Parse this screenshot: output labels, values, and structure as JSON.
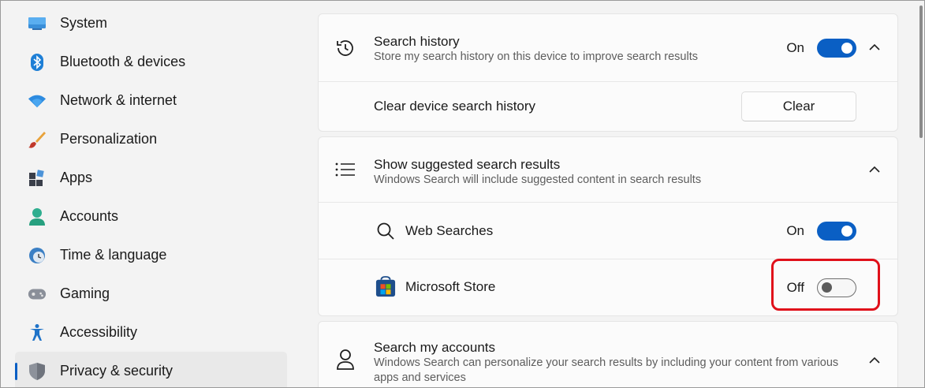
{
  "sidebar": {
    "items": [
      {
        "label": "System",
        "icon": "monitor-icon"
      },
      {
        "label": "Bluetooth & devices",
        "icon": "bluetooth-icon"
      },
      {
        "label": "Network & internet",
        "icon": "wifi-icon"
      },
      {
        "label": "Personalization",
        "icon": "brush-icon"
      },
      {
        "label": "Apps",
        "icon": "apps-icon"
      },
      {
        "label": "Accounts",
        "icon": "person-icon"
      },
      {
        "label": "Time & language",
        "icon": "clock-globe-icon"
      },
      {
        "label": "Gaming",
        "icon": "gamepad-icon"
      },
      {
        "label": "Accessibility",
        "icon": "accessibility-icon"
      },
      {
        "label": "Privacy & security",
        "icon": "shield-icon",
        "active": true
      }
    ]
  },
  "search_history": {
    "title": "Search history",
    "subtitle": "Store my search history on this device to improve search results",
    "toggle_label": "On",
    "toggle_state": "on",
    "clear_row_label": "Clear device search history",
    "clear_button": "Clear"
  },
  "suggested": {
    "title": "Show suggested search results",
    "subtitle": "Windows Search will include suggested content in search results",
    "web_searches": {
      "label": "Web Searches",
      "toggle_label": "On",
      "toggle_state": "on"
    },
    "microsoft_store": {
      "label": "Microsoft Store",
      "toggle_label": "Off",
      "toggle_state": "off"
    }
  },
  "accounts": {
    "title": "Search my accounts",
    "subtitle_line1": "Windows Search can personalize your search results by including your content from various",
    "subtitle_line2": "apps and services"
  },
  "colors": {
    "accent": "#0a5fc4",
    "highlight": "#e0101a"
  }
}
